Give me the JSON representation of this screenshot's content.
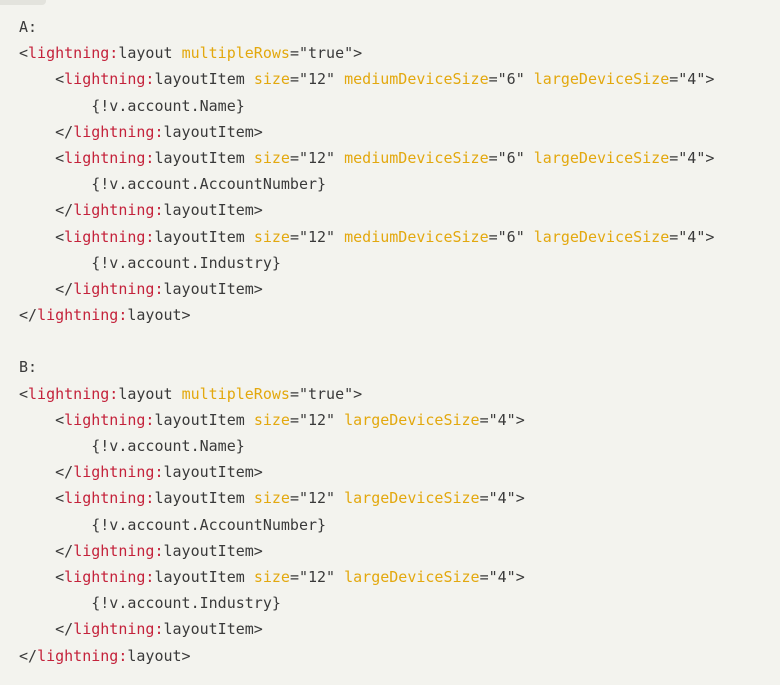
{
  "colors": {
    "background": "#f3f3ee",
    "text": "#3a3a3a",
    "namespace": "#c4223b",
    "attribute": "#e3a80e"
  },
  "code_lines": [
    [
      {
        "t": "A:",
        "k": "plain"
      }
    ],
    [
      {
        "t": "<",
        "k": "plain"
      },
      {
        "t": "lightning:",
        "k": "ns"
      },
      {
        "t": "layout ",
        "k": "plain"
      },
      {
        "t": "multipleRows",
        "k": "attr"
      },
      {
        "t": "=\"true\">",
        "k": "plain"
      }
    ],
    [
      {
        "t": "    <",
        "k": "plain"
      },
      {
        "t": "lightning:",
        "k": "ns"
      },
      {
        "t": "layoutItem ",
        "k": "plain"
      },
      {
        "t": "size",
        "k": "attr"
      },
      {
        "t": "=\"12\" ",
        "k": "plain"
      },
      {
        "t": "mediumDeviceSize",
        "k": "attr"
      },
      {
        "t": "=\"6\" ",
        "k": "plain"
      },
      {
        "t": "largeDeviceSize",
        "k": "attr"
      },
      {
        "t": "=\"4\">",
        "k": "plain"
      }
    ],
    [
      {
        "t": "        {!v.account.Name}",
        "k": "plain"
      }
    ],
    [
      {
        "t": "    </",
        "k": "plain"
      },
      {
        "t": "lightning:",
        "k": "ns"
      },
      {
        "t": "layoutItem>",
        "k": "plain"
      }
    ],
    [
      {
        "t": "    <",
        "k": "plain"
      },
      {
        "t": "lightning:",
        "k": "ns"
      },
      {
        "t": "layoutItem ",
        "k": "plain"
      },
      {
        "t": "size",
        "k": "attr"
      },
      {
        "t": "=\"12\" ",
        "k": "plain"
      },
      {
        "t": "mediumDeviceSize",
        "k": "attr"
      },
      {
        "t": "=\"6\" ",
        "k": "plain"
      },
      {
        "t": "largeDeviceSize",
        "k": "attr"
      },
      {
        "t": "=\"4\">",
        "k": "plain"
      }
    ],
    [
      {
        "t": "        {!v.account.AccountNumber}",
        "k": "plain"
      }
    ],
    [
      {
        "t": "    </",
        "k": "plain"
      },
      {
        "t": "lightning:",
        "k": "ns"
      },
      {
        "t": "layoutItem>",
        "k": "plain"
      }
    ],
    [
      {
        "t": "    <",
        "k": "plain"
      },
      {
        "t": "lightning:",
        "k": "ns"
      },
      {
        "t": "layoutItem ",
        "k": "plain"
      },
      {
        "t": "size",
        "k": "attr"
      },
      {
        "t": "=\"12\" ",
        "k": "plain"
      },
      {
        "t": "mediumDeviceSize",
        "k": "attr"
      },
      {
        "t": "=\"6\" ",
        "k": "plain"
      },
      {
        "t": "largeDeviceSize",
        "k": "attr"
      },
      {
        "t": "=\"4\">",
        "k": "plain"
      }
    ],
    [
      {
        "t": "        {!v.account.Industry}",
        "k": "plain"
      }
    ],
    [
      {
        "t": "    </",
        "k": "plain"
      },
      {
        "t": "lightning:",
        "k": "ns"
      },
      {
        "t": "layoutItem>",
        "k": "plain"
      }
    ],
    [
      {
        "t": "</",
        "k": "plain"
      },
      {
        "t": "lightning:",
        "k": "ns"
      },
      {
        "t": "layout>",
        "k": "plain"
      }
    ],
    [],
    [
      {
        "t": "B:",
        "k": "plain"
      }
    ],
    [
      {
        "t": "<",
        "k": "plain"
      },
      {
        "t": "lightning:",
        "k": "ns"
      },
      {
        "t": "layout ",
        "k": "plain"
      },
      {
        "t": "multipleRows",
        "k": "attr"
      },
      {
        "t": "=\"true\">",
        "k": "plain"
      }
    ],
    [
      {
        "t": "    <",
        "k": "plain"
      },
      {
        "t": "lightning:",
        "k": "ns"
      },
      {
        "t": "layoutItem ",
        "k": "plain"
      },
      {
        "t": "size",
        "k": "attr"
      },
      {
        "t": "=\"12\" ",
        "k": "plain"
      },
      {
        "t": "largeDeviceSize",
        "k": "attr"
      },
      {
        "t": "=\"4\">",
        "k": "plain"
      }
    ],
    [
      {
        "t": "        {!v.account.Name}",
        "k": "plain"
      }
    ],
    [
      {
        "t": "    </",
        "k": "plain"
      },
      {
        "t": "lightning:",
        "k": "ns"
      },
      {
        "t": "layoutItem>",
        "k": "plain"
      }
    ],
    [
      {
        "t": "    <",
        "k": "plain"
      },
      {
        "t": "lightning:",
        "k": "ns"
      },
      {
        "t": "layoutItem ",
        "k": "plain"
      },
      {
        "t": "size",
        "k": "attr"
      },
      {
        "t": "=\"12\" ",
        "k": "plain"
      },
      {
        "t": "largeDeviceSize",
        "k": "attr"
      },
      {
        "t": "=\"4\">",
        "k": "plain"
      }
    ],
    [
      {
        "t": "        {!v.account.AccountNumber}",
        "k": "plain"
      }
    ],
    [
      {
        "t": "    </",
        "k": "plain"
      },
      {
        "t": "lightning:",
        "k": "ns"
      },
      {
        "t": "layoutItem>",
        "k": "plain"
      }
    ],
    [
      {
        "t": "    <",
        "k": "plain"
      },
      {
        "t": "lightning:",
        "k": "ns"
      },
      {
        "t": "layoutItem ",
        "k": "plain"
      },
      {
        "t": "size",
        "k": "attr"
      },
      {
        "t": "=\"12\" ",
        "k": "plain"
      },
      {
        "t": "largeDeviceSize",
        "k": "attr"
      },
      {
        "t": "=\"4\">",
        "k": "plain"
      }
    ],
    [
      {
        "t": "        {!v.account.Industry}",
        "k": "plain"
      }
    ],
    [
      {
        "t": "    </",
        "k": "plain"
      },
      {
        "t": "lightning:",
        "k": "ns"
      },
      {
        "t": "layoutItem>",
        "k": "plain"
      }
    ],
    [
      {
        "t": "</",
        "k": "plain"
      },
      {
        "t": "lightning:",
        "k": "ns"
      },
      {
        "t": "layout>",
        "k": "plain"
      }
    ]
  ]
}
